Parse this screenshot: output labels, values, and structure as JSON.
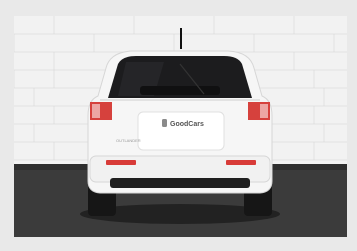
{
  "photo": {
    "subject": "white SUV rear view parked against a white brick wall",
    "badge_text": "GoodCars",
    "model_badge_text": "OUTLANDER",
    "colors": {
      "wall": "#f2f2f2",
      "brick_line": "#d9d9d9",
      "car_body": "#f7f7f7",
      "glass": "#1b1b1d",
      "floor": "#3a3a3a",
      "taillight": "#e23a3a"
    }
  }
}
